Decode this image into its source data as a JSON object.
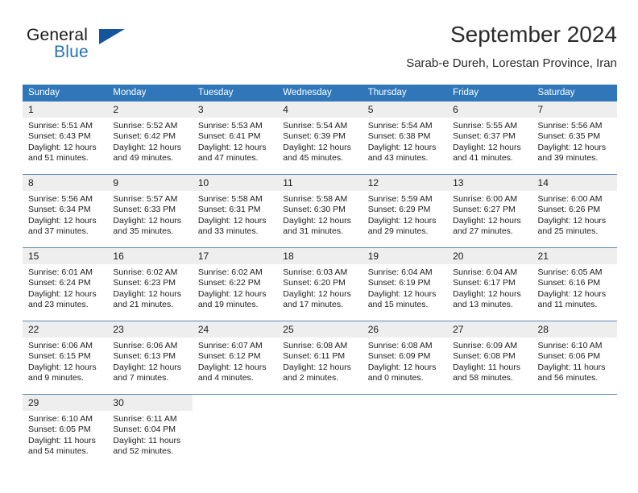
{
  "brand": {
    "name_part1": "General",
    "name_part2": "Blue",
    "flag_icon": "triangle-flag-icon",
    "accent_color": "#2572b8",
    "flag_color": "#14559e"
  },
  "header": {
    "month_title": "September 2024",
    "location": "Sarab-e Dureh, Lorestan Province, Iran"
  },
  "calendar": {
    "header_bg": "#2f77b9",
    "daynum_bg": "#eeeeee",
    "weekday_headers": [
      "Sunday",
      "Monday",
      "Tuesday",
      "Wednesday",
      "Thursday",
      "Friday",
      "Saturday"
    ],
    "weeks": [
      [
        {
          "day": "1",
          "sunrise": "Sunrise: 5:51 AM",
          "sunset": "Sunset: 6:43 PM",
          "daylight_line1": "Daylight: 12 hours",
          "daylight_line2": "and 51 minutes."
        },
        {
          "day": "2",
          "sunrise": "Sunrise: 5:52 AM",
          "sunset": "Sunset: 6:42 PM",
          "daylight_line1": "Daylight: 12 hours",
          "daylight_line2": "and 49 minutes."
        },
        {
          "day": "3",
          "sunrise": "Sunrise: 5:53 AM",
          "sunset": "Sunset: 6:41 PM",
          "daylight_line1": "Daylight: 12 hours",
          "daylight_line2": "and 47 minutes."
        },
        {
          "day": "4",
          "sunrise": "Sunrise: 5:54 AM",
          "sunset": "Sunset: 6:39 PM",
          "daylight_line1": "Daylight: 12 hours",
          "daylight_line2": "and 45 minutes."
        },
        {
          "day": "5",
          "sunrise": "Sunrise: 5:54 AM",
          "sunset": "Sunset: 6:38 PM",
          "daylight_line1": "Daylight: 12 hours",
          "daylight_line2": "and 43 minutes."
        },
        {
          "day": "6",
          "sunrise": "Sunrise: 5:55 AM",
          "sunset": "Sunset: 6:37 PM",
          "daylight_line1": "Daylight: 12 hours",
          "daylight_line2": "and 41 minutes."
        },
        {
          "day": "7",
          "sunrise": "Sunrise: 5:56 AM",
          "sunset": "Sunset: 6:35 PM",
          "daylight_line1": "Daylight: 12 hours",
          "daylight_line2": "and 39 minutes."
        }
      ],
      [
        {
          "day": "8",
          "sunrise": "Sunrise: 5:56 AM",
          "sunset": "Sunset: 6:34 PM",
          "daylight_line1": "Daylight: 12 hours",
          "daylight_line2": "and 37 minutes."
        },
        {
          "day": "9",
          "sunrise": "Sunrise: 5:57 AM",
          "sunset": "Sunset: 6:33 PM",
          "daylight_line1": "Daylight: 12 hours",
          "daylight_line2": "and 35 minutes."
        },
        {
          "day": "10",
          "sunrise": "Sunrise: 5:58 AM",
          "sunset": "Sunset: 6:31 PM",
          "daylight_line1": "Daylight: 12 hours",
          "daylight_line2": "and 33 minutes."
        },
        {
          "day": "11",
          "sunrise": "Sunrise: 5:58 AM",
          "sunset": "Sunset: 6:30 PM",
          "daylight_line1": "Daylight: 12 hours",
          "daylight_line2": "and 31 minutes."
        },
        {
          "day": "12",
          "sunrise": "Sunrise: 5:59 AM",
          "sunset": "Sunset: 6:29 PM",
          "daylight_line1": "Daylight: 12 hours",
          "daylight_line2": "and 29 minutes."
        },
        {
          "day": "13",
          "sunrise": "Sunrise: 6:00 AM",
          "sunset": "Sunset: 6:27 PM",
          "daylight_line1": "Daylight: 12 hours",
          "daylight_line2": "and 27 minutes."
        },
        {
          "day": "14",
          "sunrise": "Sunrise: 6:00 AM",
          "sunset": "Sunset: 6:26 PM",
          "daylight_line1": "Daylight: 12 hours",
          "daylight_line2": "and 25 minutes."
        }
      ],
      [
        {
          "day": "15",
          "sunrise": "Sunrise: 6:01 AM",
          "sunset": "Sunset: 6:24 PM",
          "daylight_line1": "Daylight: 12 hours",
          "daylight_line2": "and 23 minutes."
        },
        {
          "day": "16",
          "sunrise": "Sunrise: 6:02 AM",
          "sunset": "Sunset: 6:23 PM",
          "daylight_line1": "Daylight: 12 hours",
          "daylight_line2": "and 21 minutes."
        },
        {
          "day": "17",
          "sunrise": "Sunrise: 6:02 AM",
          "sunset": "Sunset: 6:22 PM",
          "daylight_line1": "Daylight: 12 hours",
          "daylight_line2": "and 19 minutes."
        },
        {
          "day": "18",
          "sunrise": "Sunrise: 6:03 AM",
          "sunset": "Sunset: 6:20 PM",
          "daylight_line1": "Daylight: 12 hours",
          "daylight_line2": "and 17 minutes."
        },
        {
          "day": "19",
          "sunrise": "Sunrise: 6:04 AM",
          "sunset": "Sunset: 6:19 PM",
          "daylight_line1": "Daylight: 12 hours",
          "daylight_line2": "and 15 minutes."
        },
        {
          "day": "20",
          "sunrise": "Sunrise: 6:04 AM",
          "sunset": "Sunset: 6:17 PM",
          "daylight_line1": "Daylight: 12 hours",
          "daylight_line2": "and 13 minutes."
        },
        {
          "day": "21",
          "sunrise": "Sunrise: 6:05 AM",
          "sunset": "Sunset: 6:16 PM",
          "daylight_line1": "Daylight: 12 hours",
          "daylight_line2": "and 11 minutes."
        }
      ],
      [
        {
          "day": "22",
          "sunrise": "Sunrise: 6:06 AM",
          "sunset": "Sunset: 6:15 PM",
          "daylight_line1": "Daylight: 12 hours",
          "daylight_line2": "and 9 minutes."
        },
        {
          "day": "23",
          "sunrise": "Sunrise: 6:06 AM",
          "sunset": "Sunset: 6:13 PM",
          "daylight_line1": "Daylight: 12 hours",
          "daylight_line2": "and 7 minutes."
        },
        {
          "day": "24",
          "sunrise": "Sunrise: 6:07 AM",
          "sunset": "Sunset: 6:12 PM",
          "daylight_line1": "Daylight: 12 hours",
          "daylight_line2": "and 4 minutes."
        },
        {
          "day": "25",
          "sunrise": "Sunrise: 6:08 AM",
          "sunset": "Sunset: 6:11 PM",
          "daylight_line1": "Daylight: 12 hours",
          "daylight_line2": "and 2 minutes."
        },
        {
          "day": "26",
          "sunrise": "Sunrise: 6:08 AM",
          "sunset": "Sunset: 6:09 PM",
          "daylight_line1": "Daylight: 12 hours",
          "daylight_line2": "and 0 minutes."
        },
        {
          "day": "27",
          "sunrise": "Sunrise: 6:09 AM",
          "sunset": "Sunset: 6:08 PM",
          "daylight_line1": "Daylight: 11 hours",
          "daylight_line2": "and 58 minutes."
        },
        {
          "day": "28",
          "sunrise": "Sunrise: 6:10 AM",
          "sunset": "Sunset: 6:06 PM",
          "daylight_line1": "Daylight: 11 hours",
          "daylight_line2": "and 56 minutes."
        }
      ],
      [
        {
          "day": "29",
          "sunrise": "Sunrise: 6:10 AM",
          "sunset": "Sunset: 6:05 PM",
          "daylight_line1": "Daylight: 11 hours",
          "daylight_line2": "and 54 minutes."
        },
        {
          "day": "30",
          "sunrise": "Sunrise: 6:11 AM",
          "sunset": "Sunset: 6:04 PM",
          "daylight_line1": "Daylight: 11 hours",
          "daylight_line2": "and 52 minutes."
        },
        {
          "day": "",
          "sunrise": "",
          "sunset": "",
          "daylight_line1": "",
          "daylight_line2": ""
        },
        {
          "day": "",
          "sunrise": "",
          "sunset": "",
          "daylight_line1": "",
          "daylight_line2": ""
        },
        {
          "day": "",
          "sunrise": "",
          "sunset": "",
          "daylight_line1": "",
          "daylight_line2": ""
        },
        {
          "day": "",
          "sunrise": "",
          "sunset": "",
          "daylight_line1": "",
          "daylight_line2": ""
        },
        {
          "day": "",
          "sunrise": "",
          "sunset": "",
          "daylight_line1": "",
          "daylight_line2": ""
        }
      ]
    ]
  }
}
